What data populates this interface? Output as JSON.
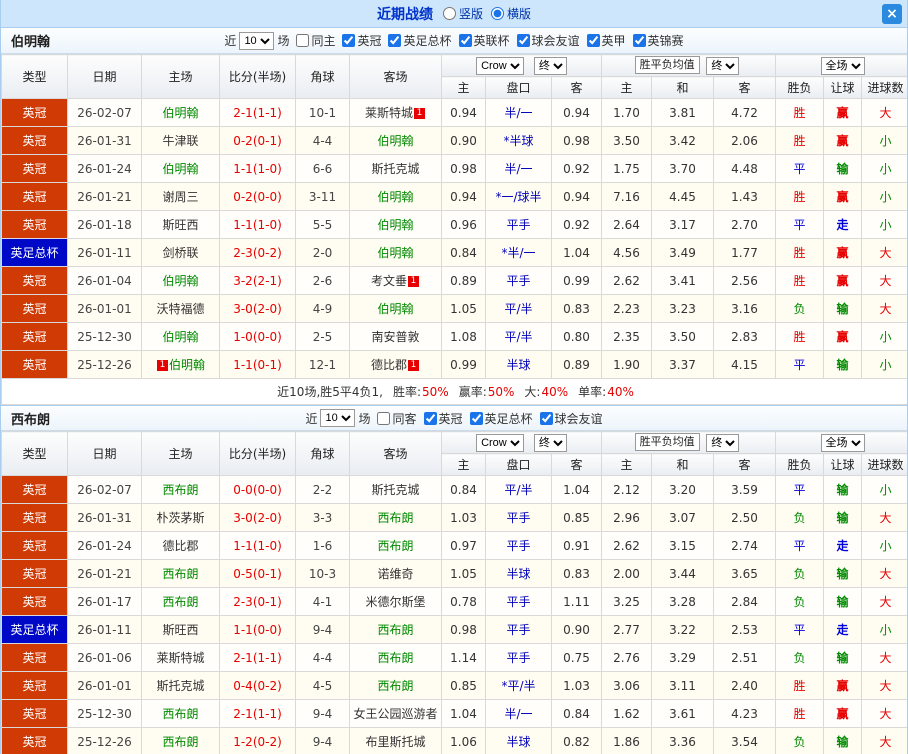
{
  "topbar": {
    "title": "近期战绩",
    "view_options": [
      {
        "label": "竖版",
        "selected": false
      },
      {
        "label": "横版",
        "selected": true
      }
    ],
    "close_label": "×"
  },
  "filter": {
    "near_prefix": "近",
    "near_count": "10",
    "near_suffix": "场"
  },
  "table_header": {
    "type": "类型",
    "date": "日期",
    "home": "主场",
    "score": "比分(半场)",
    "corner": "角球",
    "away": "客场",
    "odds_company": "Crow",
    "odds_final": "终",
    "odds_sub": [
      "主",
      "盘口",
      "客"
    ],
    "avg_label": "胜平负均值",
    "avg_final": "终",
    "avg_sub": [
      "主",
      "和",
      "客"
    ],
    "fulltime": "全场",
    "result_sub": [
      "胜负",
      "让球",
      "进球数"
    ]
  },
  "colors": {
    "league_bg": "#cf3a05",
    "cup_bg": "#0008c8",
    "win_red": "#e60000",
    "draw_blue": "#0000dd",
    "lose_green": "#008a00",
    "focus_team_green": "#008a00",
    "topbar_bg": "#cde6fb",
    "accent_blue": "#2a8ae0"
  },
  "sections": [
    {
      "team": "伯明翰",
      "checkboxes": [
        {
          "label": "同主",
          "checked": false
        },
        {
          "label": "英冠",
          "checked": true
        },
        {
          "label": "英足总杯",
          "checked": true
        },
        {
          "label": "英联杯",
          "checked": true
        },
        {
          "label": "球会友谊",
          "checked": true
        },
        {
          "label": "英甲",
          "checked": true
        },
        {
          "label": "英锦赛",
          "checked": true
        }
      ],
      "rows": [
        {
          "league": "英冠",
          "cup": false,
          "date": "26-02-07",
          "home": {
            "name": "伯明翰",
            "focus": true
          },
          "score": "2-1(1-1)",
          "corner": "10-1",
          "away": {
            "name": "莱斯特城",
            "focus": false,
            "badge": "1"
          },
          "odds": [
            "0.94",
            "半/一",
            "0.94"
          ],
          "avg": [
            "1.70",
            "3.81",
            "4.72"
          ],
          "result": [
            "胜",
            "赢",
            "大"
          ]
        },
        {
          "league": "英冠",
          "cup": false,
          "date": "26-01-31",
          "home": {
            "name": "牛津联",
            "focus": false
          },
          "score": "0-2(0-1)",
          "corner": "4-4",
          "away": {
            "name": "伯明翰",
            "focus": true
          },
          "odds": [
            "0.90",
            "*半球",
            "0.98"
          ],
          "avg": [
            "3.50",
            "3.42",
            "2.06"
          ],
          "result": [
            "胜",
            "赢",
            "小"
          ]
        },
        {
          "league": "英冠",
          "cup": false,
          "date": "26-01-24",
          "home": {
            "name": "伯明翰",
            "focus": true
          },
          "score": "1-1(1-0)",
          "corner": "6-6",
          "away": {
            "name": "斯托克城",
            "focus": false
          },
          "odds": [
            "0.98",
            "半/一",
            "0.92"
          ],
          "avg": [
            "1.75",
            "3.70",
            "4.48"
          ],
          "result": [
            "平",
            "输",
            "小"
          ]
        },
        {
          "league": "英冠",
          "cup": false,
          "date": "26-01-21",
          "home": {
            "name": "谢周三",
            "focus": false
          },
          "score": "0-2(0-0)",
          "corner": "3-11",
          "away": {
            "name": "伯明翰",
            "focus": true
          },
          "odds": [
            "0.94",
            "*一/球半",
            "0.94"
          ],
          "avg": [
            "7.16",
            "4.45",
            "1.43"
          ],
          "result": [
            "胜",
            "赢",
            "小"
          ]
        },
        {
          "league": "英冠",
          "cup": false,
          "date": "26-01-18",
          "home": {
            "name": "斯旺西",
            "focus": false
          },
          "score": "1-1(1-0)",
          "corner": "5-5",
          "away": {
            "name": "伯明翰",
            "focus": true
          },
          "odds": [
            "0.96",
            "平手",
            "0.92"
          ],
          "avg": [
            "2.64",
            "3.17",
            "2.70"
          ],
          "result": [
            "平",
            "走",
            "小"
          ]
        },
        {
          "league": "英足总杯",
          "cup": true,
          "date": "26-01-11",
          "home": {
            "name": "剑桥联",
            "focus": false
          },
          "score": "2-3(0-2)",
          "corner": "2-0",
          "away": {
            "name": "伯明翰",
            "focus": true
          },
          "odds": [
            "0.84",
            "*半/一",
            "1.04"
          ],
          "avg": [
            "4.56",
            "3.49",
            "1.77"
          ],
          "result": [
            "胜",
            "赢",
            "大"
          ]
        },
        {
          "league": "英冠",
          "cup": false,
          "date": "26-01-04",
          "home": {
            "name": "伯明翰",
            "focus": true
          },
          "score": "3-2(2-1)",
          "corner": "2-6",
          "away": {
            "name": "考文垂",
            "focus": false,
            "badge": "1"
          },
          "odds": [
            "0.89",
            "平手",
            "0.99"
          ],
          "avg": [
            "2.62",
            "3.41",
            "2.56"
          ],
          "result": [
            "胜",
            "赢",
            "大"
          ]
        },
        {
          "league": "英冠",
          "cup": false,
          "date": "26-01-01",
          "home": {
            "name": "沃特福德",
            "focus": false
          },
          "score": "3-0(2-0)",
          "corner": "4-9",
          "away": {
            "name": "伯明翰",
            "focus": true
          },
          "odds": [
            "1.05",
            "平/半",
            "0.83"
          ],
          "avg": [
            "2.23",
            "3.23",
            "3.16"
          ],
          "result": [
            "负",
            "输",
            "大"
          ]
        },
        {
          "league": "英冠",
          "cup": false,
          "date": "25-12-30",
          "home": {
            "name": "伯明翰",
            "focus": true
          },
          "score": "1-0(0-0)",
          "corner": "2-5",
          "away": {
            "name": "南安普敦",
            "focus": false
          },
          "odds": [
            "1.08",
            "平/半",
            "0.80"
          ],
          "avg": [
            "2.35",
            "3.50",
            "2.83"
          ],
          "result": [
            "胜",
            "赢",
            "小"
          ]
        },
        {
          "league": "英冠",
          "cup": false,
          "date": "25-12-26",
          "home": {
            "name": "伯明翰",
            "focus": true,
            "badge": "1",
            "badge_side": "left"
          },
          "score": "1-1(0-1)",
          "corner": "12-1",
          "away": {
            "name": "德比郡",
            "focus": false,
            "badge": "1"
          },
          "odds": [
            "0.99",
            "半球",
            "0.89"
          ],
          "avg": [
            "1.90",
            "3.37",
            "4.15"
          ],
          "result": [
            "平",
            "输",
            "小"
          ]
        }
      ],
      "summary": {
        "prefix": "近10场,胜5平4负1,",
        "stats": [
          {
            "label": "胜率:",
            "value": "50%"
          },
          {
            "label": "赢率:",
            "value": "50%"
          },
          {
            "label": "大:",
            "value": "40%"
          },
          {
            "label": "单率:",
            "value": "40%"
          }
        ]
      }
    },
    {
      "team": "西布朗",
      "checkboxes": [
        {
          "label": "同客",
          "checked": false
        },
        {
          "label": "英冠",
          "checked": true
        },
        {
          "label": "英足总杯",
          "checked": true
        },
        {
          "label": "球会友谊",
          "checked": true
        }
      ],
      "rows": [
        {
          "league": "英冠",
          "cup": false,
          "date": "26-02-07",
          "home": {
            "name": "西布朗",
            "focus": true
          },
          "score": "0-0(0-0)",
          "corner": "2-2",
          "away": {
            "name": "斯托克城",
            "focus": false
          },
          "odds": [
            "0.84",
            "平/半",
            "1.04"
          ],
          "avg": [
            "2.12",
            "3.20",
            "3.59"
          ],
          "result": [
            "平",
            "输",
            "小"
          ]
        },
        {
          "league": "英冠",
          "cup": false,
          "date": "26-01-31",
          "home": {
            "name": "朴茨茅斯",
            "focus": false
          },
          "score": "3-0(2-0)",
          "corner": "3-3",
          "away": {
            "name": "西布朗",
            "focus": true
          },
          "odds": [
            "1.03",
            "平手",
            "0.85"
          ],
          "avg": [
            "2.96",
            "3.07",
            "2.50"
          ],
          "result": [
            "负",
            "输",
            "大"
          ]
        },
        {
          "league": "英冠",
          "cup": false,
          "date": "26-01-24",
          "home": {
            "name": "德比郡",
            "focus": false
          },
          "score": "1-1(1-0)",
          "corner": "1-6",
          "away": {
            "name": "西布朗",
            "focus": true
          },
          "odds": [
            "0.97",
            "平手",
            "0.91"
          ],
          "avg": [
            "2.62",
            "3.15",
            "2.74"
          ],
          "result": [
            "平",
            "走",
            "小"
          ]
        },
        {
          "league": "英冠",
          "cup": false,
          "date": "26-01-21",
          "home": {
            "name": "西布朗",
            "focus": true
          },
          "score": "0-5(0-1)",
          "corner": "10-3",
          "away": {
            "name": "诺维奇",
            "focus": false
          },
          "odds": [
            "1.05",
            "半球",
            "0.83"
          ],
          "avg": [
            "2.00",
            "3.44",
            "3.65"
          ],
          "result": [
            "负",
            "输",
            "大"
          ]
        },
        {
          "league": "英冠",
          "cup": false,
          "date": "26-01-17",
          "home": {
            "name": "西布朗",
            "focus": true
          },
          "score": "2-3(0-1)",
          "corner": "4-1",
          "away": {
            "name": "米德尔斯堡",
            "focus": false
          },
          "odds": [
            "0.78",
            "平手",
            "1.11"
          ],
          "avg": [
            "3.25",
            "3.28",
            "2.84"
          ],
          "result": [
            "负",
            "输",
            "大"
          ]
        },
        {
          "league": "英足总杯",
          "cup": true,
          "date": "26-01-11",
          "home": {
            "name": "斯旺西",
            "focus": false
          },
          "score": "1-1(0-0)",
          "corner": "9-4",
          "away": {
            "name": "西布朗",
            "focus": true
          },
          "odds": [
            "0.98",
            "平手",
            "0.90"
          ],
          "avg": [
            "2.77",
            "3.22",
            "2.53"
          ],
          "result": [
            "平",
            "走",
            "小"
          ]
        },
        {
          "league": "英冠",
          "cup": false,
          "date": "26-01-06",
          "home": {
            "name": "莱斯特城",
            "focus": false
          },
          "score": "2-1(1-1)",
          "corner": "4-4",
          "away": {
            "name": "西布朗",
            "focus": true
          },
          "odds": [
            "1.14",
            "平手",
            "0.75"
          ],
          "avg": [
            "2.76",
            "3.29",
            "2.51"
          ],
          "result": [
            "负",
            "输",
            "大"
          ]
        },
        {
          "league": "英冠",
          "cup": false,
          "date": "26-01-01",
          "home": {
            "name": "斯托克城",
            "focus": false
          },
          "score": "0-4(0-2)",
          "corner": "4-5",
          "away": {
            "name": "西布朗",
            "focus": true
          },
          "odds": [
            "0.85",
            "*平/半",
            "1.03"
          ],
          "avg": [
            "3.06",
            "3.11",
            "2.40"
          ],
          "result": [
            "胜",
            "赢",
            "大"
          ]
        },
        {
          "league": "英冠",
          "cup": false,
          "date": "25-12-30",
          "home": {
            "name": "西布朗",
            "focus": true
          },
          "score": "2-1(1-1)",
          "corner": "9-4",
          "away": {
            "name": "女王公园巡游者",
            "focus": false
          },
          "odds": [
            "1.04",
            "半/一",
            "0.84"
          ],
          "avg": [
            "1.62",
            "3.61",
            "4.23"
          ],
          "result": [
            "胜",
            "赢",
            "大"
          ]
        },
        {
          "league": "英冠",
          "cup": false,
          "date": "25-12-26",
          "home": {
            "name": "西布朗",
            "focus": true
          },
          "score": "1-2(0-2)",
          "corner": "9-4",
          "away": {
            "name": "布里斯托城",
            "focus": false
          },
          "odds": [
            "1.06",
            "半球",
            "0.82"
          ],
          "avg": [
            "1.86",
            "3.36",
            "3.54"
          ],
          "result": [
            "负",
            "输",
            "大"
          ]
        }
      ]
    }
  ]
}
